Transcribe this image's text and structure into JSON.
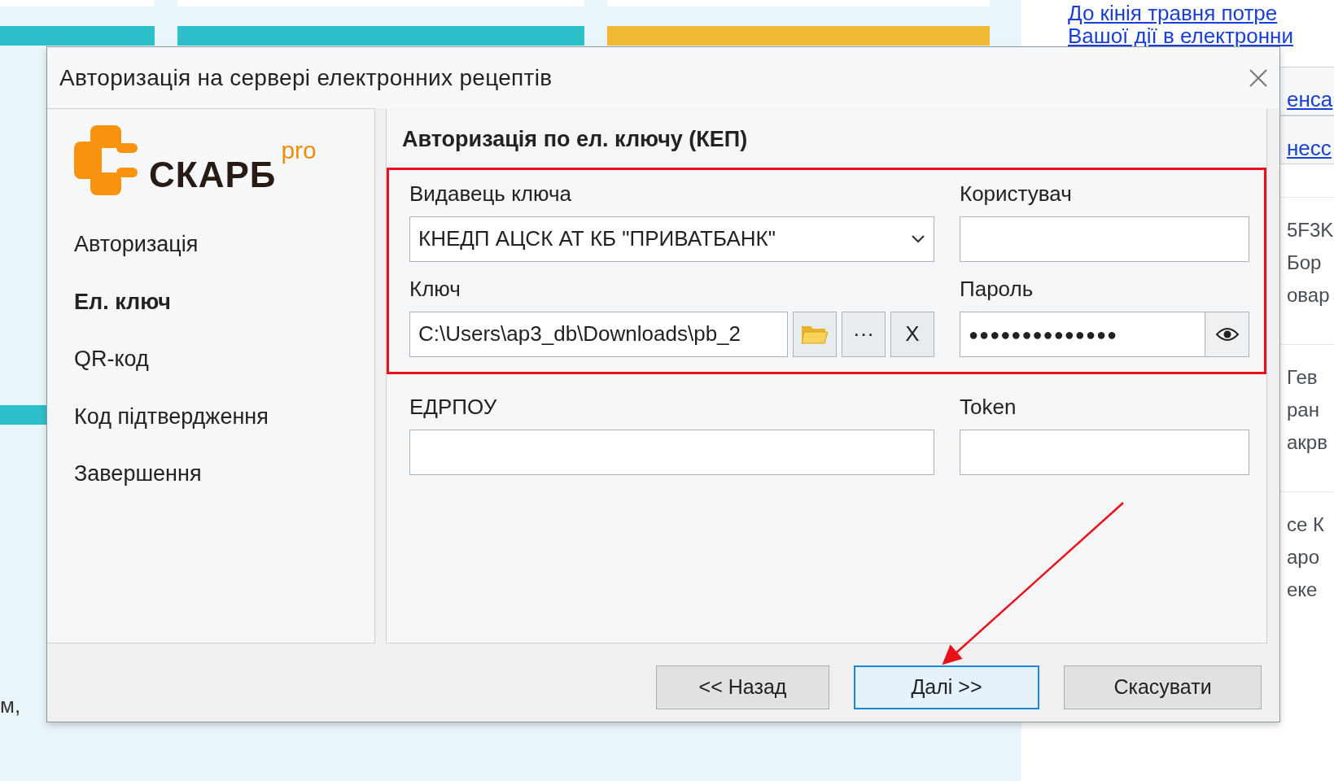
{
  "background": {
    "links": [
      "До кінія травня потре",
      "Вашої дії в електронни",
      "енса",
      "несс"
    ],
    "fragment_groups": [
      [
        "5F3K",
        "Бор",
        "овар"
      ],
      [
        "Гев",
        "ран",
        "акрв"
      ],
      [
        "се К",
        "аро",
        "еке"
      ]
    ],
    "left_fragment": "м,"
  },
  "dialog": {
    "title": "Авторизація на сервері електронних рецептів",
    "logo": {
      "name": "СКАРБ",
      "suffix": "pro"
    },
    "steps": [
      {
        "label": "Авторизація",
        "selected": false
      },
      {
        "label": "Ел. ключ",
        "selected": true
      },
      {
        "label": "QR-код",
        "selected": false
      },
      {
        "label": "Код підтвердження",
        "selected": false
      },
      {
        "label": "Завершення",
        "selected": false
      }
    ],
    "heading": "Авторизація по ел. ключу (КЕП)",
    "field_groups": [
      {
        "highlighted": true,
        "fields": [
          {
            "kind": "select",
            "label": "Видавець ключа",
            "value": "КНЕДП АЦСК АТ КБ \"ПРИВАТБАНК\""
          },
          {
            "kind": "text",
            "label": "Користувач"
          },
          {
            "kind": "file",
            "label": "Ключ",
            "value": "C:\\Users\\ap3_db\\Downloads\\pb_2",
            "browse_label": "···",
            "clear_label": "X"
          },
          {
            "kind": "password",
            "label": "Пароль",
            "value": "●●●●●●●●●●●●●●"
          }
        ]
      },
      {
        "highlighted": false,
        "fields": [
          {
            "kind": "text",
            "label": "ЕДРПОУ"
          },
          {
            "kind": "text",
            "label": "Token"
          }
        ]
      }
    ],
    "buttons": [
      {
        "label": "<< Назад",
        "default": false
      },
      {
        "label": "Далі >>",
        "default": true
      },
      {
        "label": "Скасувати",
        "default": false
      }
    ]
  }
}
